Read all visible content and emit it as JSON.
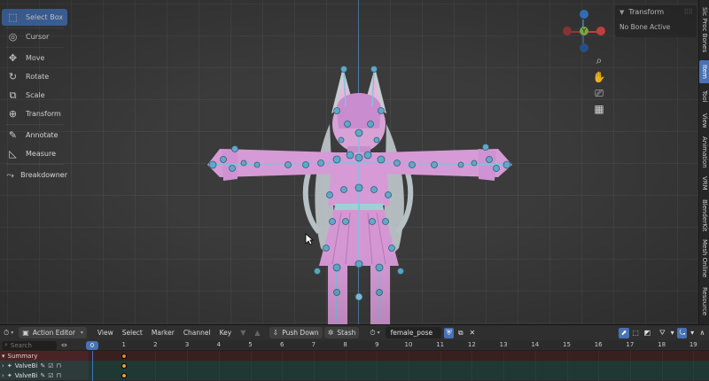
{
  "toolbar": {
    "tools": [
      {
        "label": "Select Box",
        "icon": "select-box-icon",
        "active": true
      },
      {
        "label": "Cursor",
        "icon": "cursor-icon"
      },
      {
        "label": "Move",
        "icon": "move-icon"
      },
      {
        "label": "Rotate",
        "icon": "rotate-icon"
      },
      {
        "label": "Scale",
        "icon": "scale-icon"
      },
      {
        "label": "Transform",
        "icon": "transform-icon"
      },
      {
        "label": "Annotate",
        "icon": "annotate-icon"
      },
      {
        "label": "Measure",
        "icon": "measure-icon"
      },
      {
        "label": "Breakdowner",
        "icon": "breakdowner-icon"
      }
    ]
  },
  "gizmo": {
    "y_label": "Y",
    "axis_colors": {
      "x": "#e04a4a",
      "y": "#8bc34a",
      "z": "#3b82d8"
    }
  },
  "npanel": {
    "title": "Transform",
    "message": "No Bone Active"
  },
  "right_tabs": [
    "Sic Proc Bones",
    "Item",
    "Tool",
    "View",
    "Animation",
    "VRM",
    "BlenderKit",
    "Mesh Online",
    "Resource"
  ],
  "right_tabs_active": "Item",
  "editor": {
    "mode": "Action Editor",
    "menus": [
      "View",
      "Select",
      "Marker",
      "Channel",
      "Key"
    ],
    "push_down": "Push Down",
    "stash": "Stash",
    "action_name": "female_pose",
    "search_placeholder": "Search",
    "rows": [
      {
        "label": "Summary",
        "type": "summary"
      },
      {
        "label": "ValveBi",
        "type": "obj"
      },
      {
        "label": "ValveBi",
        "type": "obj"
      }
    ],
    "current_frame": "0",
    "frames": [
      "1",
      "2",
      "3",
      "4",
      "5",
      "6",
      "7",
      "8",
      "9",
      "10",
      "11",
      "12",
      "13",
      "14",
      "15",
      "16",
      "17",
      "18",
      "19"
    ],
    "keyframe_frame": 1
  },
  "colors": {
    "accent": "#4772b3",
    "keyframe": "#f0a030",
    "mesh_pink": "#d69ad6",
    "bone_cyan": "#5fa8c8"
  }
}
